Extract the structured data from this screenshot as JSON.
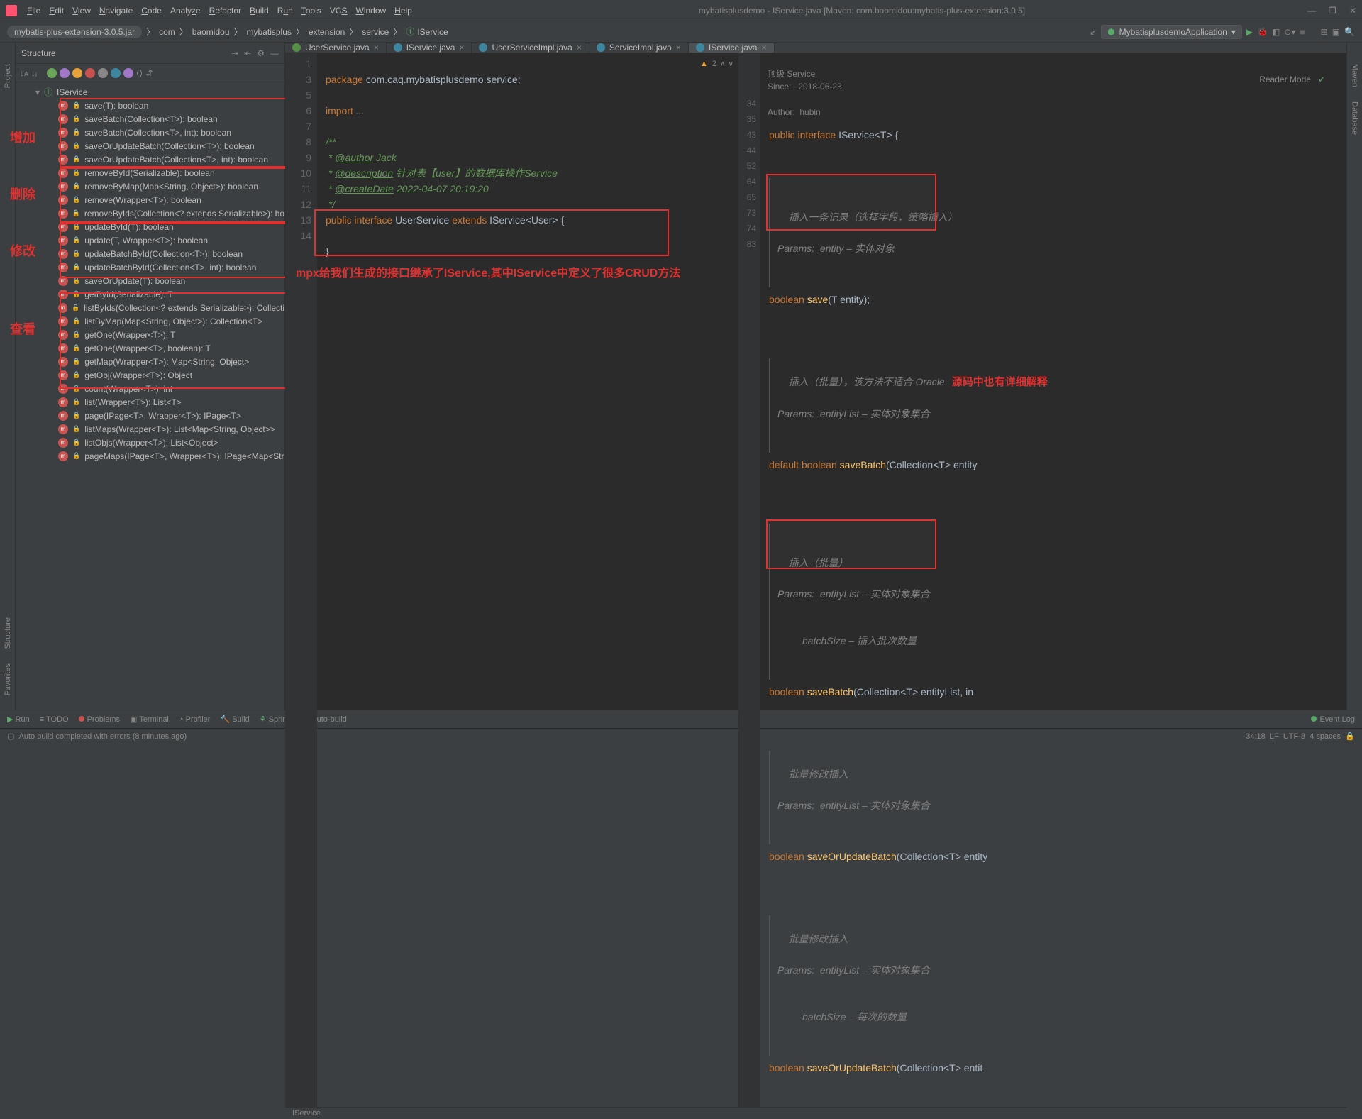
{
  "window_title": "mybatisplusdemo - IService.java [Maven: com.baomidou:mybatis-plus-extension:3.0.5]",
  "menus": [
    "File",
    "Edit",
    "View",
    "Navigate",
    "Code",
    "Analyze",
    "Refactor",
    "Build",
    "Run",
    "Tools",
    "VCS",
    "Window",
    "Help"
  ],
  "breadcrumbs": [
    "mybatis-plus-extension-3.0.5.jar",
    "com",
    "baomidou",
    "mybatisplus",
    "extension",
    "service",
    "IService"
  ],
  "run_config": "MybatisplusdemoApplication",
  "structure": {
    "title": "Structure",
    "root": "IService",
    "methods": [
      "save(T): boolean",
      "saveBatch(Collection<T>): boolean",
      "saveBatch(Collection<T>, int): boolean",
      "saveOrUpdateBatch(Collection<T>): boolean",
      "saveOrUpdateBatch(Collection<T>, int): boolean",
      "removeById(Serializable): boolean",
      "removeByMap(Map<String, Object>): boolean",
      "remove(Wrapper<T>): boolean",
      "removeByIds(Collection<? extends Serializable>): bo",
      "updateById(T): boolean",
      "update(T, Wrapper<T>): boolean",
      "updateBatchById(Collection<T>): boolean",
      "updateBatchById(Collection<T>, int): boolean",
      "saveOrUpdate(T): boolean",
      "getById(Serializable): T",
      "listByIds(Collection<? extends Serializable>): Collecti",
      "listByMap(Map<String, Object>): Collection<T>",
      "getOne(Wrapper<T>): T",
      "getOne(Wrapper<T>, boolean): T",
      "getMap(Wrapper<T>): Map<String, Object>",
      "getObj(Wrapper<T>): Object",
      "count(Wrapper<T>): int",
      "list(Wrapper<T>): List<T>",
      "page(IPage<T>, Wrapper<T>): IPage<T>",
      "listMaps(Wrapper<T>): List<Map<String, Object>>",
      "listObjs(Wrapper<T>): List<Object>",
      "pageMaps(IPage<T>, Wrapper<T>): IPage<Map<Str"
    ]
  },
  "redlabels": {
    "add": "增加",
    "delete": "删除",
    "update": "修改",
    "query": "查看"
  },
  "tabs": [
    {
      "name": "UserService.java",
      "active": false,
      "color": "#548f45"
    },
    {
      "name": "IService.java",
      "active": false,
      "color": "#3e86a0"
    },
    {
      "name": "UserServiceImpl.java",
      "active": false,
      "color": "#3e86a0"
    },
    {
      "name": "ServiceImpl.java",
      "active": false,
      "color": "#3e86a0"
    },
    {
      "name": "IService.java",
      "active": true,
      "color": "#3e86a0"
    }
  ],
  "left_editor": {
    "lines": [
      "1",
      "",
      "3",
      "",
      "5",
      "6",
      "7",
      "8",
      "9",
      "10",
      "11",
      "12",
      "13",
      "14"
    ],
    "warn_count": "2",
    "annotation": "mpx给我们生成的接口继承了IService,其中IService中定义了很多CRUD方法"
  },
  "right_editor": {
    "top_info": [
      "顶级 Service",
      "Since:   2018-06-23",
      "Author:  hubin"
    ],
    "reader_mode": "Reader Mode",
    "line_nums": [
      "34",
      "35",
      "",
      "",
      "",
      "43",
      "44",
      "",
      "",
      "",
      "52",
      "",
      "",
      "",
      "",
      "",
      "64",
      "65",
      "",
      "",
      "",
      "73",
      "74",
      "",
      "",
      "",
      "",
      "83"
    ],
    "doc1": [
      "插入一条记录（选择字段，策略插入）",
      "Params:  entity – 实体对象"
    ],
    "doc2": [
      "插入（批量），该方法不适合 Oracle",
      "Params:  entityList – 实体对象集合"
    ],
    "doc2_note": "源码中也有详细解释",
    "doc3": [
      "插入（批量）",
      "Params:  entityList – 实体对象集合",
      "         batchSize – 插入批次数量"
    ],
    "doc4": [
      "批量修改插入",
      "Params:  entityList – 实体对象集合"
    ],
    "doc5": [
      "批量修改插入",
      "Params:  entityList – 实体对象集合",
      "         batchSize – 每次的数量"
    ],
    "crumb": "IService"
  },
  "left_sidebar": [
    "Project",
    "Structure",
    "Favorites"
  ],
  "right_sidebar": [
    "Maven",
    "Database"
  ],
  "bottom_tools": [
    "Run",
    "TODO",
    "Problems",
    "Terminal",
    "Profiler",
    "Build",
    "Spring",
    "Auto-build"
  ],
  "event_log": "Event Log",
  "status": {
    "msg": "Auto build completed with errors (8 minutes ago)",
    "pos": "34:18",
    "lf": "LF",
    "enc": "UTF-8",
    "indent": "4 spaces"
  }
}
